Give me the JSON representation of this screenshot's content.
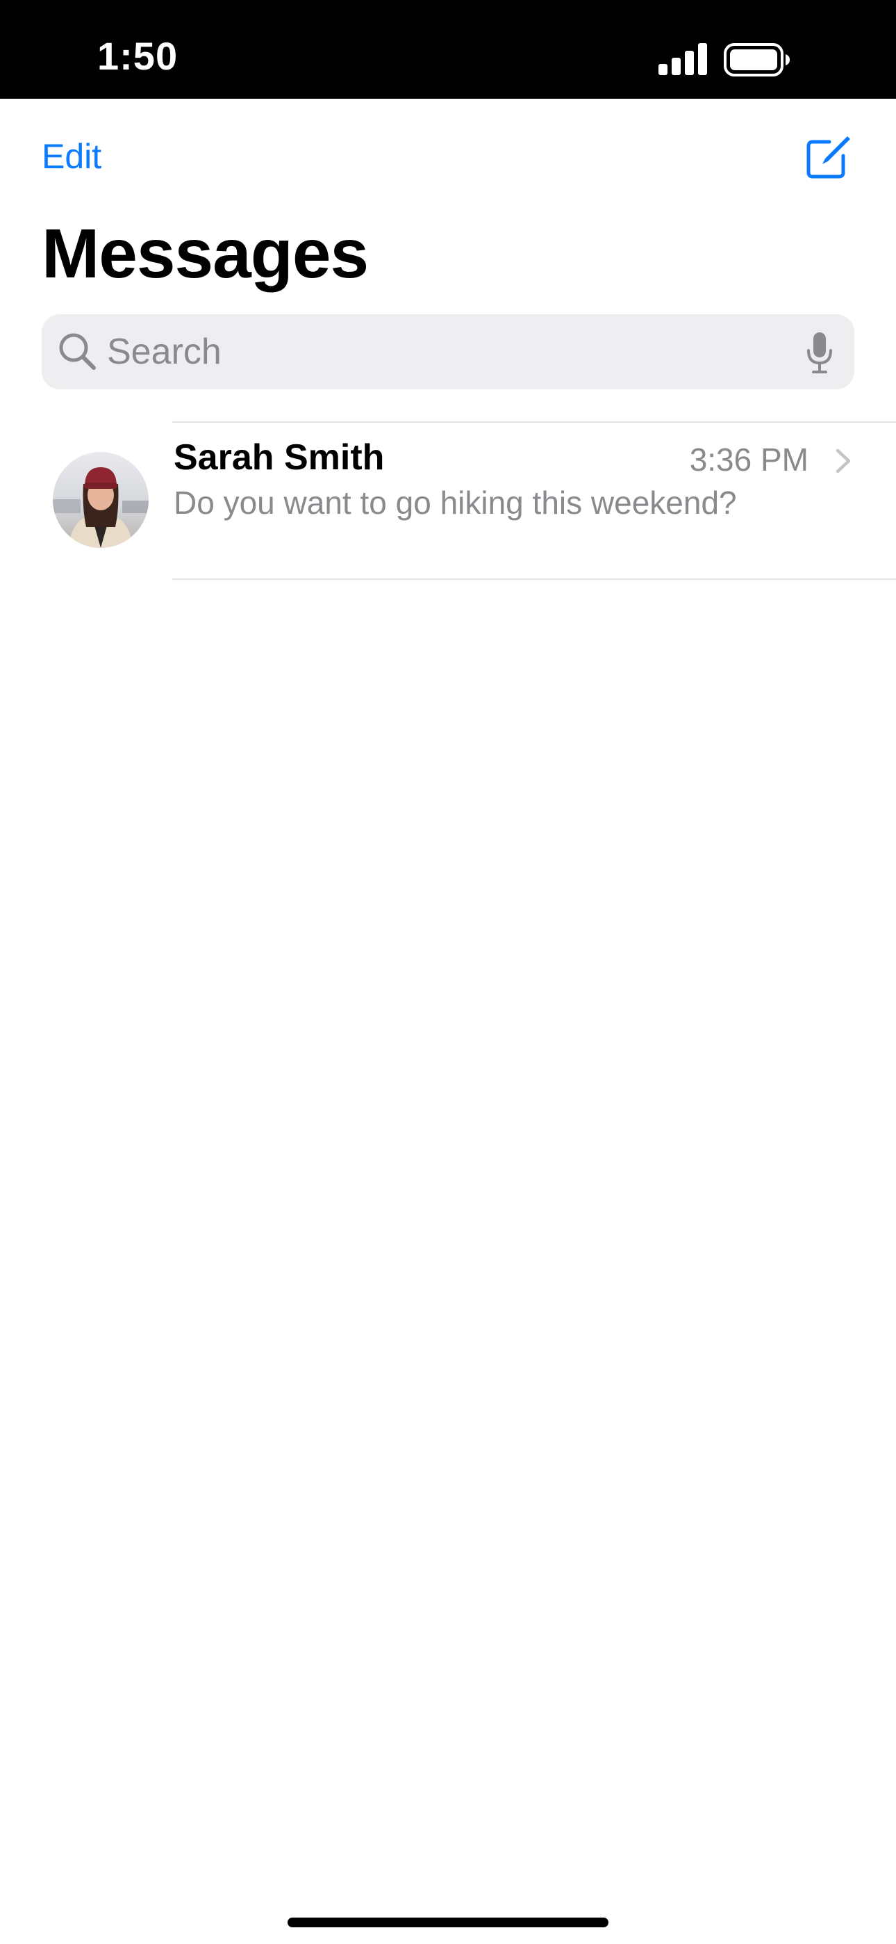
{
  "status_bar": {
    "time": "1:50",
    "signal_icon": "cellular-signal-icon",
    "battery_icon": "battery-full-icon"
  },
  "nav": {
    "edit_label": "Edit",
    "compose_icon": "compose-icon",
    "title": "Messages"
  },
  "search": {
    "placeholder": "Search",
    "value": "",
    "search_icon": "magnifying-glass-icon",
    "mic_icon": "microphone-icon"
  },
  "conversations": [
    {
      "name": "Sarah Smith",
      "time": "3:36 PM",
      "preview": "Do you want to go hiking this weekend?",
      "avatar": "contact-photo"
    }
  ],
  "colors": {
    "accent": "#0a7aff",
    "secondary_text": "#8a8a8e",
    "search_background": "#eeeef0",
    "divider": "#e3e3e5"
  }
}
